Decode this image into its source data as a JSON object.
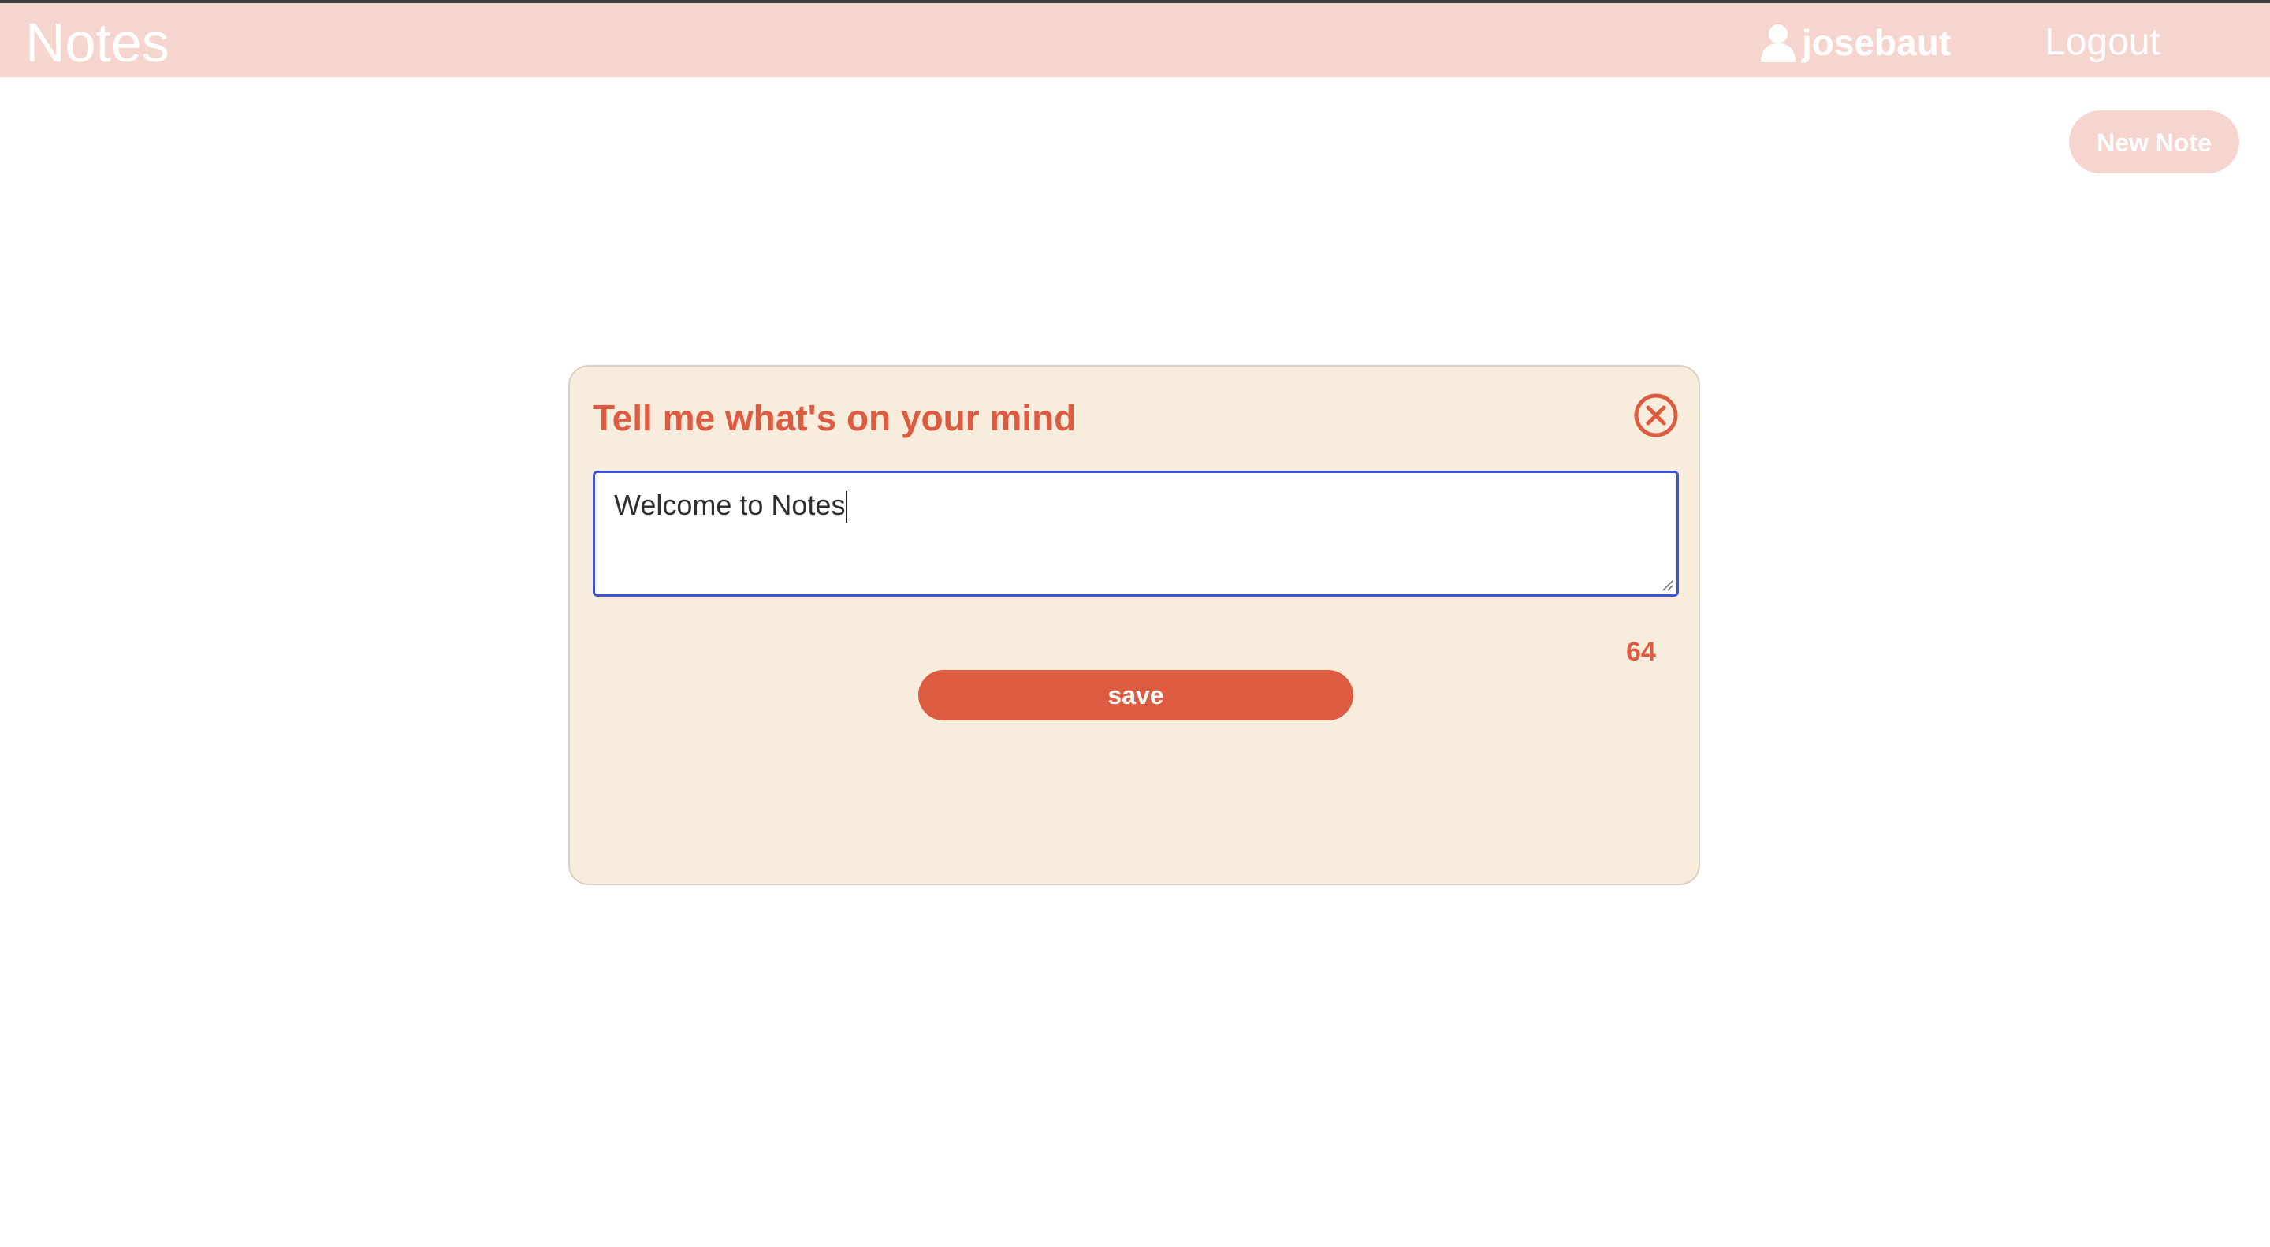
{
  "navbar": {
    "brand": "Notes",
    "username": "josebaut",
    "logout_label": "Logout",
    "user_icon": "user-icon"
  },
  "toolbar": {
    "new_note_label": "New Note"
  },
  "modal": {
    "title": "Tell me what's on your mind",
    "close_icon": "close-circle-icon",
    "textarea_value": "Welcome to Notes",
    "char_counter": "64",
    "save_label": "save"
  },
  "colors": {
    "navbar_bg": "#f6d5cf",
    "accent": "#dd5b40",
    "modal_bg": "#f8ecdd",
    "focus_border": "#3d55d6"
  }
}
